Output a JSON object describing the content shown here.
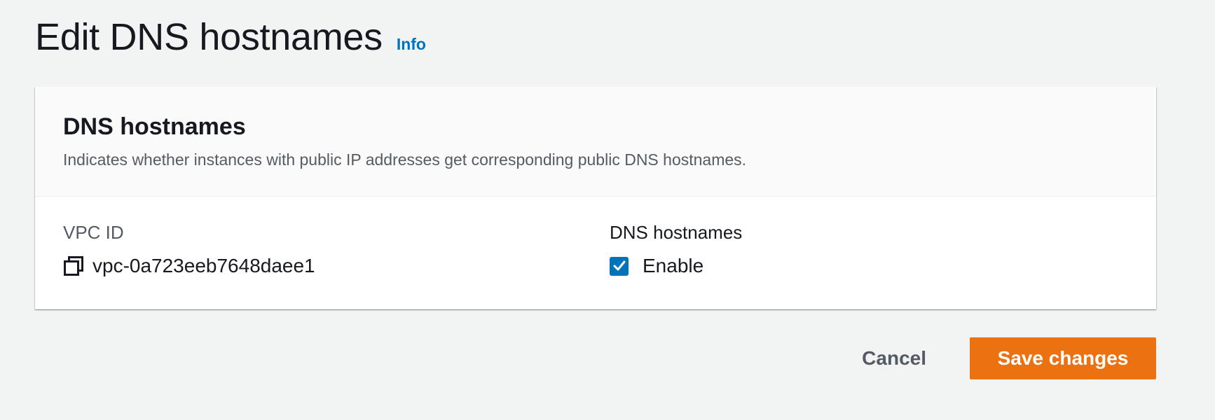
{
  "header": {
    "title": "Edit DNS hostnames",
    "info_link": "Info"
  },
  "card": {
    "title": "DNS hostnames",
    "description": "Indicates whether instances with public IP addresses get corresponding public DNS hostnames.",
    "vpc": {
      "label": "VPC ID",
      "value": "vpc-0a723eeb7648daee1",
      "icon": "copy-icon"
    },
    "dns": {
      "label": "DNS hostnames",
      "checkbox_label": "Enable",
      "checked": true
    }
  },
  "actions": {
    "cancel_label": "Cancel",
    "save_label": "Save changes"
  },
  "colors": {
    "accent": "#0073bb",
    "primary_button": "#ec7211",
    "background": "#f2f3f3"
  }
}
